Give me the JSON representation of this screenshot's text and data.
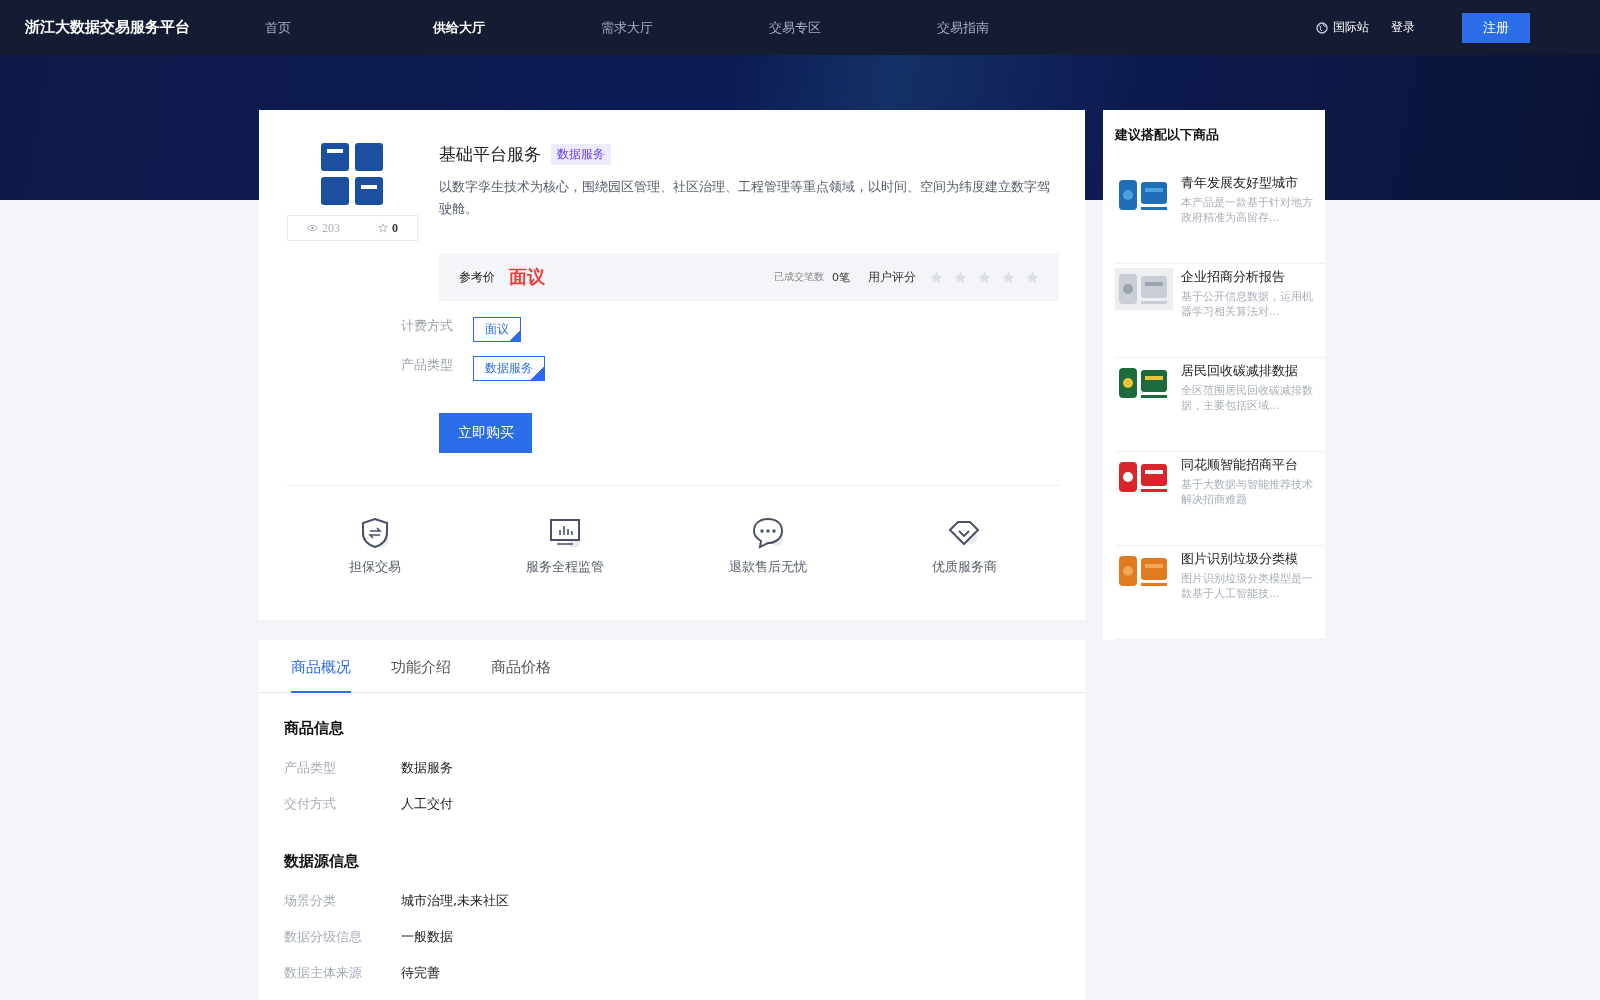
{
  "header": {
    "logo": "浙江大数据交易服务平台",
    "nav": [
      {
        "label": "首页",
        "selected": false
      },
      {
        "label": "供给大厅",
        "selected": true
      },
      {
        "label": "需求大厅",
        "selected": false
      },
      {
        "label": "交易专区",
        "selected": false
      },
      {
        "label": "交易指南",
        "selected": false
      }
    ],
    "language": "国际站",
    "login": "登录",
    "register": "注册"
  },
  "product": {
    "views": "203",
    "favorites": "0",
    "title": "基础平台服务",
    "tag": "数据服务",
    "description": "以数字孪生技术为核心，围绕园区管理、社区治理、工程管理等重点领域，以时间、空间为纬度建立数字驾驶舱。",
    "price_label": "参考价",
    "price": "面议",
    "deals_label": "已成交笔数",
    "deals": "0笔",
    "rating_label": "用户评分",
    "stars": 0,
    "options": [
      {
        "label": "计费方式",
        "value": "面议"
      },
      {
        "label": "产品类型",
        "value": "数据服务"
      }
    ],
    "buy": "立即购买",
    "guarantees": [
      {
        "kind": "shield",
        "label": "担保交易"
      },
      {
        "kind": "monitor",
        "label": "服务全程监管"
      },
      {
        "kind": "chat",
        "label": "退款售后无忧"
      },
      {
        "kind": "diamond",
        "label": "优质服务商"
      }
    ]
  },
  "details": {
    "tabs": [
      {
        "label": "商品概况",
        "selected": true
      },
      {
        "label": "功能介绍",
        "selected": false
      },
      {
        "label": "商品价格",
        "selected": false
      }
    ],
    "sections": [
      {
        "title": "商品信息",
        "rows": [
          {
            "label": "产品类型",
            "value": "数据服务"
          },
          {
            "label": "交付方式",
            "value": "人工交付"
          }
        ]
      },
      {
        "title": "数据源信息",
        "rows": [
          {
            "label": "场景分类",
            "value": "城市治理,未来社区"
          },
          {
            "label": "数据分级信息",
            "value": "一般数据"
          },
          {
            "label": "数据主体来源",
            "value": "待完善"
          }
        ]
      }
    ]
  },
  "recommend": {
    "title": "建议搭配以下商品",
    "items": [
      {
        "title": "青年发展友好型城市",
        "description": "本产品是一款基于针对地方政府精准为高留存..."
      },
      {
        "title": "企业招商分析报告",
        "description": "基于公开信息数据，运用机器学习相关算法对..."
      },
      {
        "title": "居民回收碳减排数据",
        "description": "全区范围居民回收碳减排数据，主要包括区域..."
      },
      {
        "title": "同花顺智能招商平台",
        "description": "基于大数据与智能推荐技术解决招商难题"
      },
      {
        "title": "图片识别垃圾分类模",
        "description": "图片识别垃圾分类模型是一款基于人工智能技..."
      }
    ]
  }
}
